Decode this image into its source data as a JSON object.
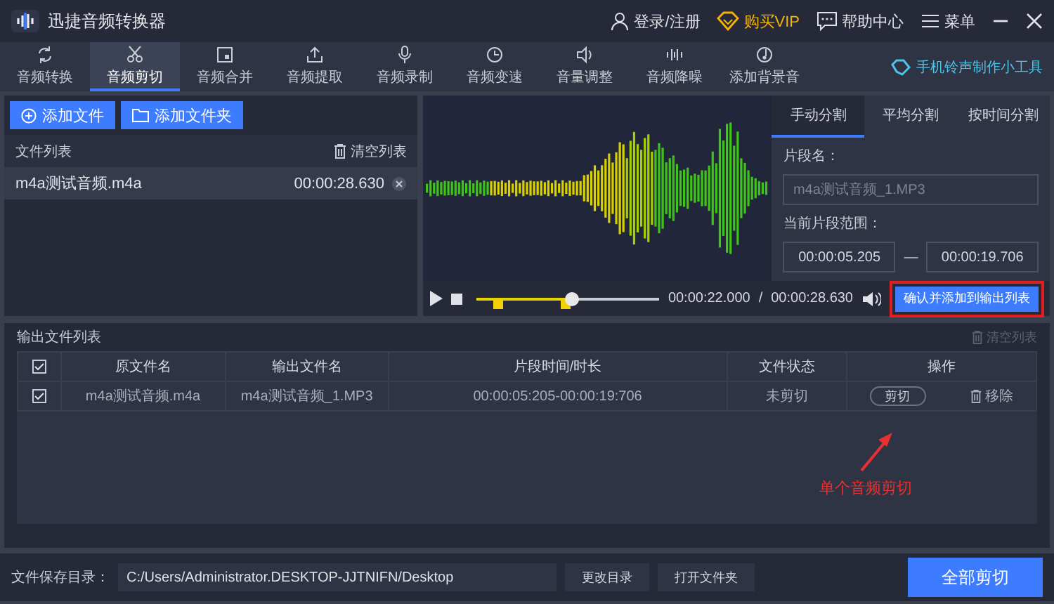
{
  "window": {
    "title": "迅捷音频转换器",
    "actions": [
      {
        "kind": "user",
        "label": "登录/注册"
      },
      {
        "kind": "vip",
        "label": "购买VIP"
      },
      {
        "kind": "help",
        "label": "帮助中心"
      },
      {
        "kind": "menu",
        "label": "菜单"
      }
    ]
  },
  "tabs": [
    {
      "label": "音频转换",
      "selected": false
    },
    {
      "label": "音频剪切",
      "selected": true
    },
    {
      "label": "音频合并",
      "selected": false
    },
    {
      "label": "音频提取",
      "selected": false
    },
    {
      "label": "音频录制",
      "selected": false
    },
    {
      "label": "音频变速",
      "selected": false
    },
    {
      "label": "音量调整",
      "selected": false
    },
    {
      "label": "音频降噪",
      "selected": false
    },
    {
      "label": "添加背景音",
      "selected": false
    }
  ],
  "tool_link": "手机铃声制作小工具",
  "file_panel": {
    "buttons": [
      "添加文件",
      "添加文件夹"
    ],
    "title": "文件列表",
    "clear": "清空列表",
    "files": [
      {
        "name": "m4a测试音频.m4a",
        "duration": "00:00:28.630",
        "selected": true
      }
    ]
  },
  "split_tabs": [
    {
      "label": "手动分割",
      "selected": true
    },
    {
      "label": "平均分割",
      "selected": false
    },
    {
      "label": "按时间分割",
      "selected": false
    }
  ],
  "segment": {
    "name_label": "片段名：",
    "name_value": "m4a测试音频_1.MP3",
    "range_label": "当前片段范围：",
    "start": "00:00:05.205",
    "separator": "—",
    "end": "00:00:19.706"
  },
  "player": {
    "progress": {
      "level": 0.52
    },
    "markers": [
      {
        "level": 0.11
      },
      {
        "level": 0.48
      }
    ],
    "current": "00:00:22.000",
    "slash": "/",
    "total": "00:00:28.630"
  },
  "confirm_button": {
    "label": "确认并添加到输出列表",
    "highlighted": true
  },
  "output": {
    "title": "输出文件列表",
    "clear": {
      "label": "清空列表",
      "disabled": true
    },
    "header_checked": true,
    "columns": [
      "原文件名",
      "输出文件名",
      "片段时间/时长",
      "文件状态",
      "操作"
    ],
    "rows": [
      {
        "checked": true,
        "source": "m4a测试音频.m4a",
        "output": "m4a测试音频_1.MP3",
        "range": "00:00:05:205-00:00:19:706",
        "status": "未剪切",
        "cut": "剪切",
        "remove": "移除"
      }
    ],
    "annotation": "单个音频剪切"
  },
  "footer": {
    "label": "文件保存目录：",
    "path": "C:/Users/Administrator.DESKTOP-JJTNIFN/Desktop",
    "buttons": [
      "更改目录",
      "打开文件夹"
    ],
    "primary": "全部剪切"
  }
}
